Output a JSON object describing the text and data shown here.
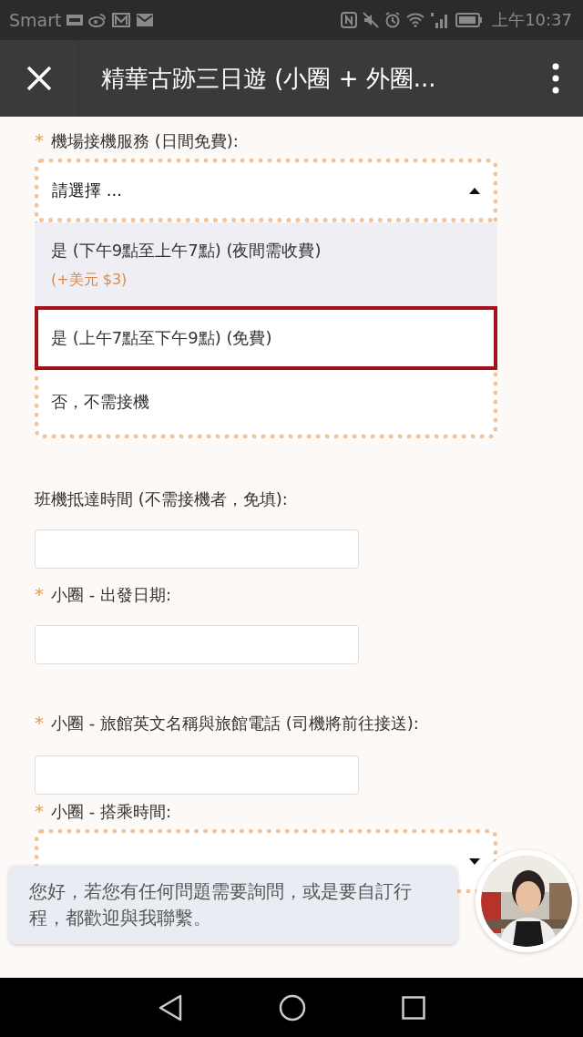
{
  "status_bar": {
    "carrier": "Smart",
    "time": "上午10:37"
  },
  "title_bar": {
    "title": "精華古跡三日遊 (小圈 + 外圈..."
  },
  "fields": [
    {
      "kind": "select",
      "required_mark": "*",
      "label": "機場接機服務 (日間免費):",
      "value": "請選擇 ...",
      "expanded": true,
      "options": [
        {
          "label": "是 (下午9點至上午7點) (夜間需收費)",
          "price": "(+美元 $3)",
          "highlighted": true,
          "selected": false
        },
        {
          "label": "是 (上午7點至下午9點) (免費)",
          "highlighted": false,
          "selected": true
        },
        {
          "label": "否，不需接機",
          "highlighted": false,
          "selected": false
        }
      ]
    },
    {
      "kind": "input",
      "label": "班機抵達時間 (不需接機者，免填):"
    },
    {
      "kind": "input",
      "required_mark": "*",
      "label": "小圈 - 出發日期:"
    },
    {
      "kind": "input",
      "required_mark": "*",
      "label": "小圈 - 旅館英文名稱與旅館電話 (司機將前往接送):"
    },
    {
      "kind": "select",
      "required_mark": "*",
      "label": "小圈 - 搭乘時間:",
      "expanded": false
    }
  ],
  "chat": {
    "message": "您好，若您有任何問題需要詢問，或是要自訂行程，都歡迎與我聯繫。"
  }
}
